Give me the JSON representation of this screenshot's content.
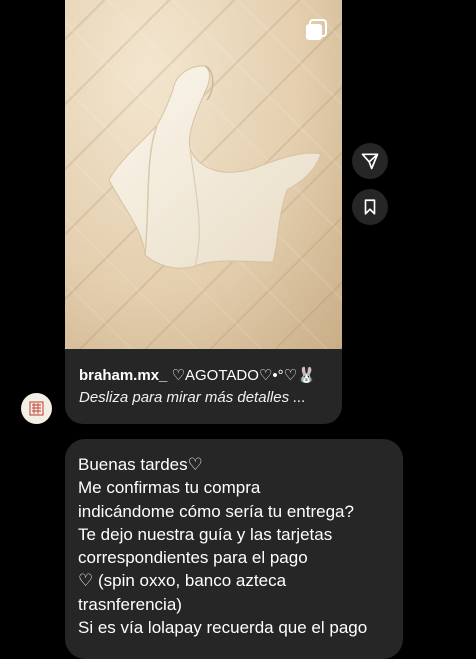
{
  "shared_post": {
    "username": "braham.mx_",
    "title": "♡AGOTADO♡•°♡🐰",
    "caption": "Desliza para mirar más detalles ..."
  },
  "message": {
    "lines": [
      "Buenas tardes♡",
      "Me confirmas tu compra",
      "indicándome cómo  sería  tu entrega?",
      "Te dejo nuestra guía  y las tarjetas",
      "correspondientes para el pago",
      "♡ (spin oxxo, banco azteca",
      "trasnferencia)",
      "Si es vía  lolapay recuerda que el pago"
    ]
  },
  "icons": {
    "multi": "carousel-icon",
    "share": "send-icon",
    "save": "bookmark-icon",
    "avatar": "shop-logo"
  }
}
